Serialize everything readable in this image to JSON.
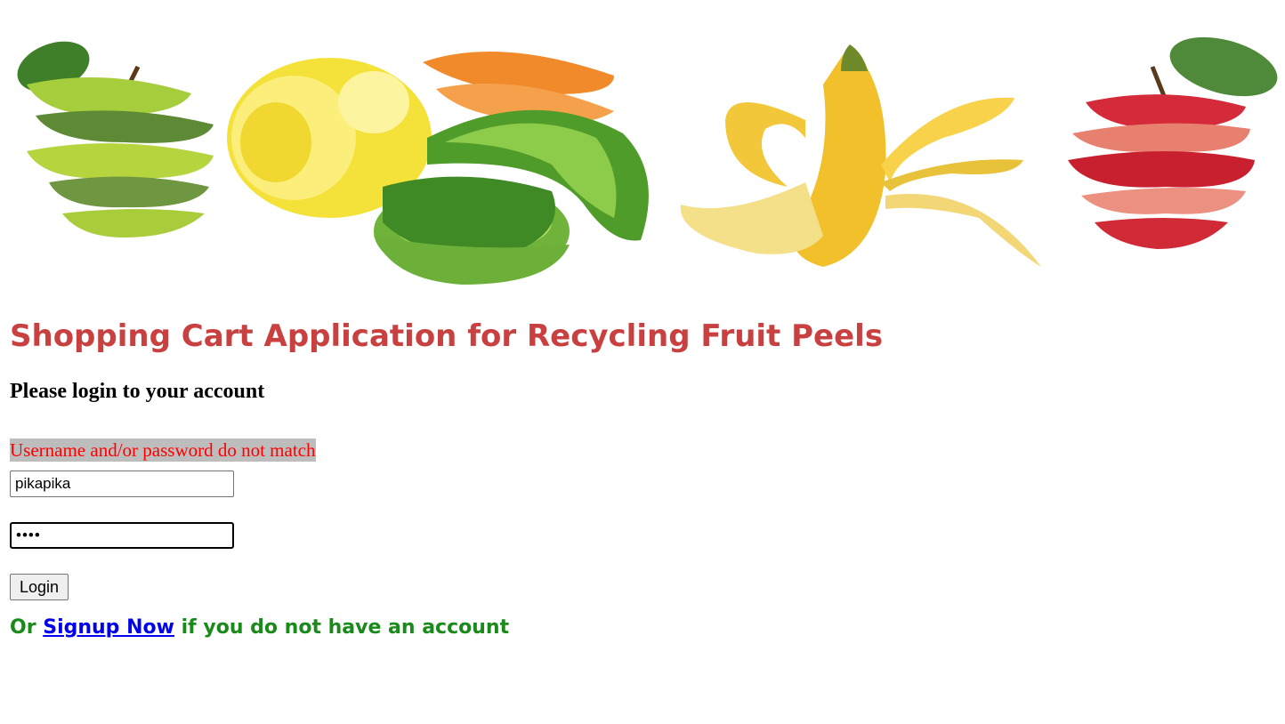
{
  "page": {
    "title": "Shopping Cart Application for Recycling Fruit Peels",
    "subtitle": "Please login to your account"
  },
  "banner": {
    "icons": [
      "green-apple-peel-icon",
      "lemon-peel-icon",
      "orange-peel-icon",
      "lime-peel-icon",
      "banana-peel-icon",
      "red-apple-peel-icon"
    ]
  },
  "login_form": {
    "error_message": "Username and/or password do not match",
    "username_value": "pikapika",
    "password_value": "••••",
    "login_label": "Login"
  },
  "signup": {
    "prefix": "Or ",
    "link_label": "Signup Now",
    "suffix": " if you do not have an account"
  },
  "colors": {
    "title": "#c94040",
    "error_text": "#ff0000",
    "error_bg": "#bdbdbd",
    "signup_text": "#1a8a1a",
    "link": "#0000ee"
  }
}
